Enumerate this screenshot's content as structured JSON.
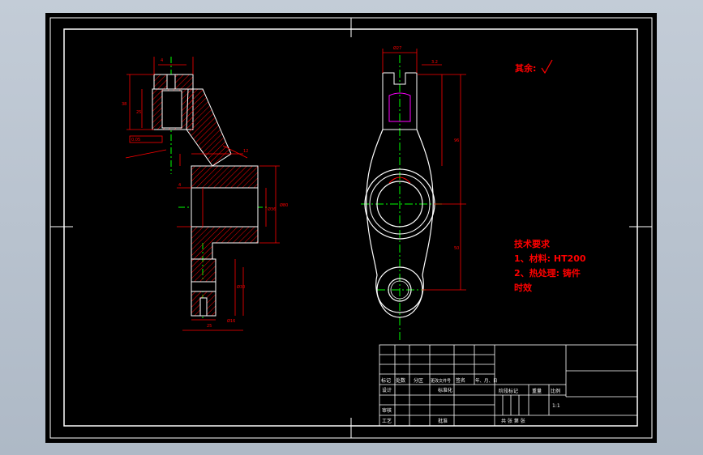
{
  "colors": {
    "background": "#b9c3cf",
    "sheet": "#000000",
    "frame": "#ffffff",
    "dimension": "#ff0000",
    "centerline": "#00ff00",
    "hatch": "#ff0000",
    "thread": "#ff00ff"
  },
  "roughness_note": "其余:",
  "technical_requirements": {
    "title": "技术要求",
    "line1": "1、材料: HT200",
    "line2": "2、热处理: 铸件",
    "line3": "时效"
  },
  "title_block": {
    "row_labels": [
      "标记",
      "处数",
      "分区",
      "更改文件号",
      "签名",
      "年、月、日"
    ],
    "design": "设计",
    "standardize": "标准化",
    "review": "审核",
    "process": "工艺",
    "approve": "批准",
    "stage_mark": "阶段标记",
    "weight": "重量",
    "scale": "比例",
    "scale_value": "1:1",
    "sheets": "共   张  第   张"
  }
}
